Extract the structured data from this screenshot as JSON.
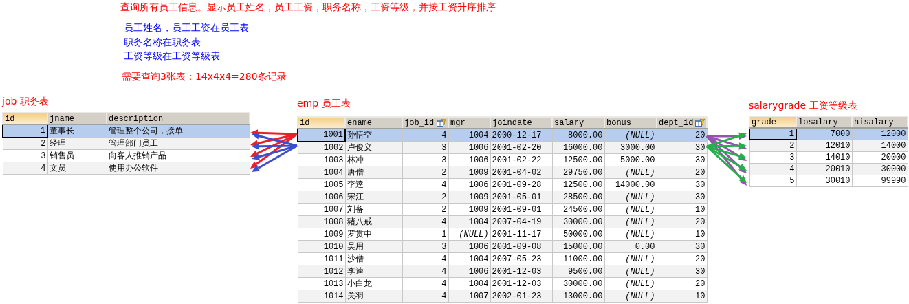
{
  "title": "查询所有员工信息。显示员工姓名，员工工资，职务名称，工资等级，并按工资升序排序",
  "notes": [
    "员工姓名，员工工资在员工表",
    "职务名称在职务表",
    "工资等级在工资等级表"
  ],
  "count_note": "需要查询3张表：14x4x4=280条记录",
  "tables": [
    {
      "caption": "job 职务表",
      "columns": [
        {
          "name": "id",
          "numeric": true,
          "filter_icon": false
        },
        {
          "name": "jname",
          "numeric": false,
          "filter_icon": false
        },
        {
          "name": "description",
          "numeric": false,
          "filter_icon": false
        }
      ],
      "rows": [
        {
          "selected": true,
          "cells": [
            "1",
            "董事长",
            "管理整个公司，接单"
          ]
        },
        {
          "selected": false,
          "cells": [
            "2",
            "经理",
            "管理部门员工"
          ]
        },
        {
          "selected": false,
          "cells": [
            "3",
            "销售员",
            "向客人推销产品"
          ]
        },
        {
          "selected": false,
          "cells": [
            "4",
            "文员",
            "使用办公软件"
          ]
        }
      ]
    },
    {
      "caption": "emp 员工表",
      "columns": [
        {
          "name": "id",
          "numeric": true,
          "filter_icon": false
        },
        {
          "name": "ename",
          "numeric": false,
          "filter_icon": false
        },
        {
          "name": "job_id",
          "numeric": true,
          "filter_icon": true
        },
        {
          "name": "mgr",
          "numeric": true,
          "filter_icon": false
        },
        {
          "name": "joindate",
          "numeric": false,
          "filter_icon": false
        },
        {
          "name": "salary",
          "numeric": true,
          "filter_icon": false
        },
        {
          "name": "bonus",
          "numeric": true,
          "filter_icon": false
        },
        {
          "name": "dept_id",
          "numeric": true,
          "filter_icon": true
        }
      ],
      "rows": [
        {
          "selected": true,
          "cells": [
            "1001",
            "孙悟空",
            "4",
            "1004",
            "2000-12-17",
            "8000.00",
            {
              "text": "(NULL)",
              "kind": "null"
            },
            "20"
          ]
        },
        {
          "selected": false,
          "cells": [
            "1002",
            "卢俊义",
            "3",
            "1006",
            "2001-02-20",
            "16000.00",
            "3000.00",
            "30"
          ]
        },
        {
          "selected": false,
          "cells": [
            "1003",
            "林冲",
            "3",
            "1006",
            "2001-02-22",
            "12500.00",
            "5000.00",
            "30"
          ]
        },
        {
          "selected": false,
          "cells": [
            "1004",
            "唐僧",
            "2",
            "1009",
            "2001-04-02",
            "29750.00",
            {
              "text": "(NULL)",
              "kind": "null"
            },
            "20"
          ]
        },
        {
          "selected": false,
          "cells": [
            "1005",
            "李逵",
            "4",
            "1006",
            "2001-09-28",
            "12500.00",
            "14000.00",
            "30"
          ]
        },
        {
          "selected": false,
          "cells": [
            "1006",
            "宋江",
            "2",
            "1009",
            "2001-05-01",
            "28500.00",
            {
              "text": "(NULL)",
              "kind": "null"
            },
            "30"
          ]
        },
        {
          "selected": false,
          "cells": [
            "1007",
            "刘备",
            "2",
            "1009",
            "2001-09-01",
            "24500.00",
            {
              "text": "(NULL)",
              "kind": "null"
            },
            "10"
          ]
        },
        {
          "selected": false,
          "cells": [
            "1008",
            "猪八戒",
            "4",
            "1004",
            "2007-04-19",
            "30000.00",
            {
              "text": "(NULL)",
              "kind": "null"
            },
            "20"
          ]
        },
        {
          "selected": false,
          "cells": [
            "1009",
            "罗贯中",
            "1",
            {
              "text": "(NULL)",
              "kind": "null"
            },
            "2001-11-17",
            "50000.00",
            {
              "text": "(NULL)",
              "kind": "null"
            },
            "10"
          ]
        },
        {
          "selected": false,
          "cells": [
            "1010",
            "吴用",
            "3",
            "1006",
            "2001-09-08",
            "15000.00",
            "0.00",
            "30"
          ]
        },
        {
          "selected": false,
          "cells": [
            "1011",
            "沙僧",
            "4",
            "1004",
            "2007-05-23",
            "11000.00",
            {
              "text": "(NULL)",
              "kind": "null"
            },
            "20"
          ]
        },
        {
          "selected": false,
          "cells": [
            "1012",
            "李逵",
            "4",
            "1006",
            "2001-12-03",
            "9500.00",
            {
              "text": "(NULL)",
              "kind": "null"
            },
            "30"
          ]
        },
        {
          "selected": false,
          "cells": [
            "1013",
            "小白龙",
            "4",
            "1004",
            "2001-12-03",
            "30000.00",
            {
              "text": "(NULL)",
              "kind": "null"
            },
            "20"
          ]
        },
        {
          "selected": false,
          "cells": [
            "1014",
            "关羽",
            "4",
            "1007",
            "2002-01-23",
            "13000.00",
            {
              "text": "(NULL)",
              "kind": "null"
            },
            "10"
          ]
        }
      ]
    },
    {
      "caption": "salarygrade 工资等级表",
      "columns": [
        {
          "name": "grade",
          "numeric": true,
          "filter_icon": false
        },
        {
          "name": "losalary",
          "numeric": true,
          "filter_icon": false
        },
        {
          "name": "hisalary",
          "numeric": true,
          "filter_icon": false
        }
      ],
      "rows": [
        {
          "selected": true,
          "cells": [
            "1",
            "7000",
            "12000"
          ]
        },
        {
          "selected": false,
          "cells": [
            "2",
            "12010",
            "14000"
          ]
        },
        {
          "selected": false,
          "cells": [
            "3",
            "14010",
            "20000"
          ]
        },
        {
          "selected": false,
          "cells": [
            "4",
            "20010",
            "30000"
          ]
        },
        {
          "selected": false,
          "cells": [
            "5",
            "30010",
            "99990"
          ]
        }
      ]
    }
  ]
}
